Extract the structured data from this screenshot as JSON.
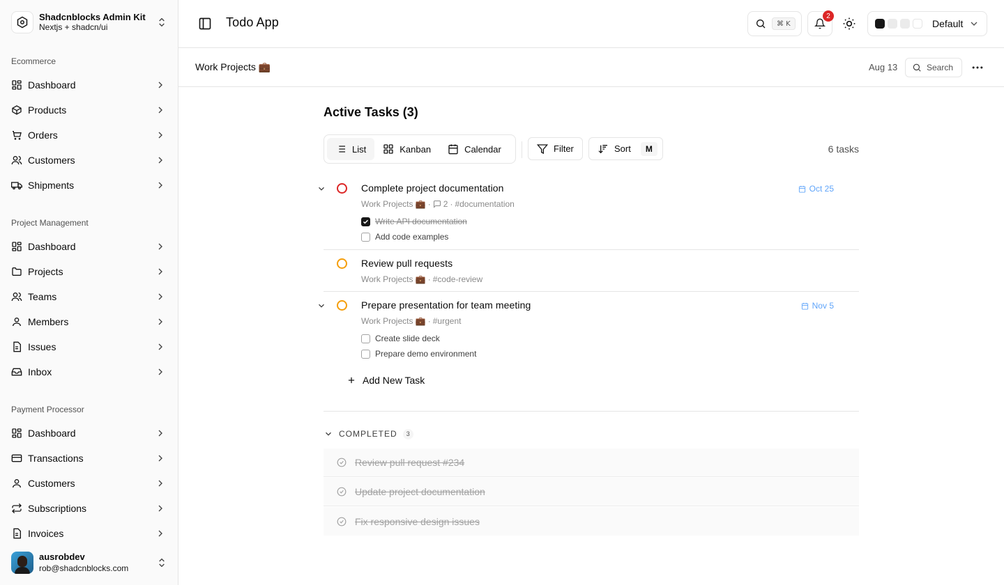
{
  "brand": {
    "title": "Shadcnblocks Admin Kit",
    "subtitle": "Nextjs + shadcn/ui"
  },
  "sidebar": {
    "groups": [
      {
        "label": "Ecommerce",
        "items": [
          {
            "label": "Dashboard",
            "icon": "grid-icon"
          },
          {
            "label": "Products",
            "icon": "box-icon"
          },
          {
            "label": "Orders",
            "icon": "cart-icon"
          },
          {
            "label": "Customers",
            "icon": "users-icon"
          },
          {
            "label": "Shipments",
            "icon": "truck-icon"
          }
        ]
      },
      {
        "label": "Project Management",
        "items": [
          {
            "label": "Dashboard",
            "icon": "grid-icon"
          },
          {
            "label": "Projects",
            "icon": "folder-icon"
          },
          {
            "label": "Teams",
            "icon": "users-icon"
          },
          {
            "label": "Members",
            "icon": "user-icon"
          },
          {
            "label": "Issues",
            "icon": "file-icon"
          },
          {
            "label": "Inbox",
            "icon": "inbox-icon"
          }
        ]
      },
      {
        "label": "Payment Processor",
        "items": [
          {
            "label": "Dashboard",
            "icon": "grid-icon"
          },
          {
            "label": "Transactions",
            "icon": "card-icon"
          },
          {
            "label": "Customers",
            "icon": "user-icon"
          },
          {
            "label": "Subscriptions",
            "icon": "repeat-icon"
          },
          {
            "label": "Invoices",
            "icon": "file-icon"
          }
        ]
      }
    ]
  },
  "user": {
    "name": "ausrobdev",
    "email": "rob@shadcnblocks.com"
  },
  "header": {
    "title": "Todo App",
    "search_shortcut": "⌘ K",
    "notifications_count": "2",
    "theme": {
      "label": "Default",
      "swatches": [
        "#171717",
        "#e5e5e5",
        "#e5e5e5",
        "#ffffff"
      ]
    }
  },
  "subheader": {
    "breadcrumb": "Work Projects 💼",
    "date": "Aug 13",
    "search_label": "Search"
  },
  "main": {
    "title": "Active Tasks (3)",
    "views": [
      "List",
      "Kanban",
      "Calendar"
    ],
    "active_view": "List",
    "filter_label": "Filter",
    "sort_label": "Sort",
    "sort_key": "M",
    "count_label": "6 tasks",
    "tasks": [
      {
        "title": "Complete project documentation",
        "project": "Work Projects 💼",
        "comments": "2",
        "tag": "#documentation",
        "date": "Oct 25",
        "status_color": "#dc2626",
        "subtasks": [
          {
            "label": "Write API documentation",
            "done": true
          },
          {
            "label": "Add code examples",
            "done": false
          }
        ]
      },
      {
        "title": "Review pull requests",
        "project": "Work Projects 💼",
        "tag": "#code-review",
        "status_color": "#f59e0b"
      },
      {
        "title": "Prepare presentation for team meeting",
        "project": "Work Projects 💼",
        "tag": "#urgent",
        "date": "Nov 5",
        "status_color": "#f59e0b",
        "subtasks": [
          {
            "label": "Create slide deck",
            "done": false
          },
          {
            "label": "Prepare demo environment",
            "done": false
          }
        ]
      }
    ],
    "add_task_label": "Add New Task",
    "completed": {
      "label": "COMPLETED",
      "count": "3",
      "items": [
        "Review pull request #234",
        "Update project documentation",
        "Fix responsive design issues"
      ]
    }
  },
  "meta_sep": "·",
  "colors": {
    "accent_date": "#60a5fa",
    "border": "#e5e5e5"
  }
}
